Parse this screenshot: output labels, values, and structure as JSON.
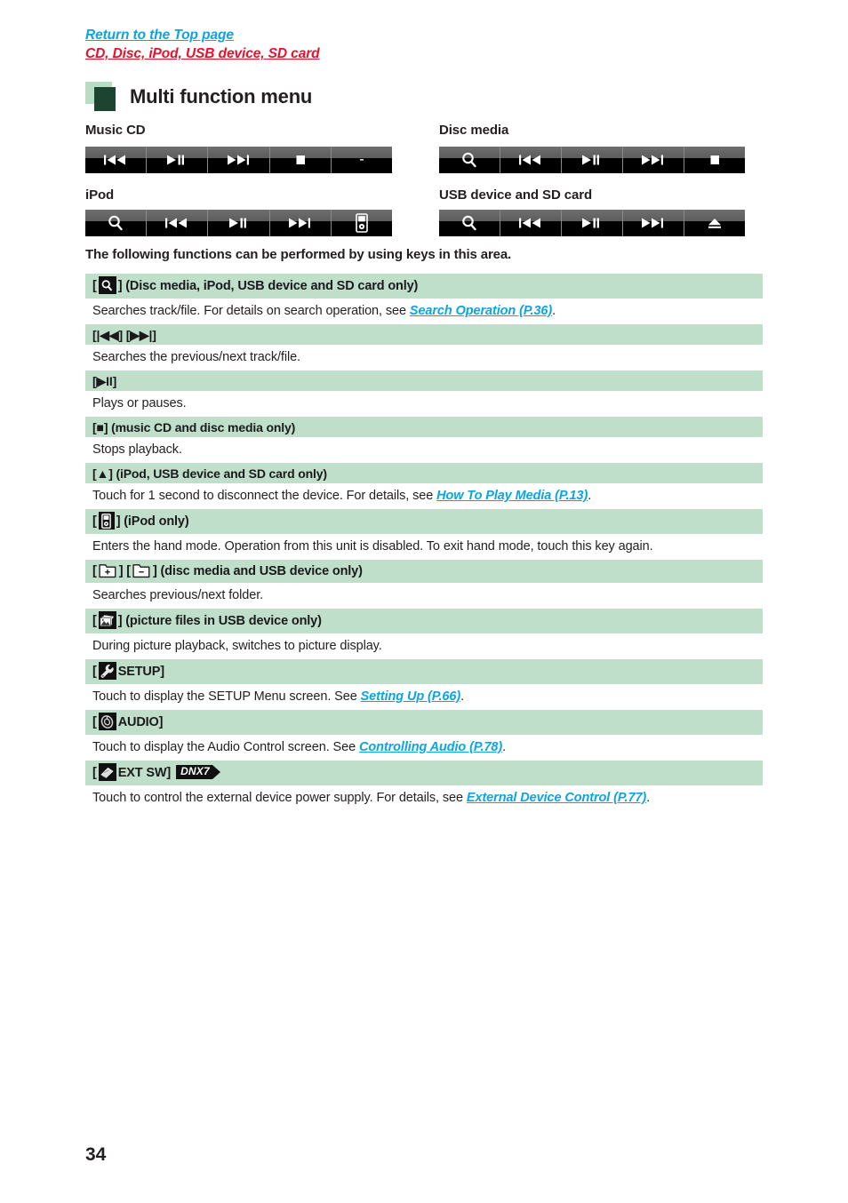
{
  "header": {
    "return_link": "Return to the Top page",
    "breadcrumb": "CD, Disc, iPod, USB device, SD card",
    "title": "Multi function menu"
  },
  "control_bars": [
    {
      "label": "Music CD",
      "keys": [
        "prev-track-icon",
        "play-pause-icon",
        "next-track-icon",
        "stop-icon",
        "blank-key"
      ]
    },
    {
      "label": "Disc media",
      "keys": [
        "search-icon",
        "prev-track-icon",
        "play-pause-icon",
        "next-track-icon",
        "stop-icon"
      ]
    },
    {
      "label": "iPod",
      "keys": [
        "search-icon",
        "prev-track-icon",
        "play-pause-icon",
        "next-track-icon",
        "ipod-hand-mode-icon"
      ]
    },
    {
      "label": "USB device and SD card",
      "keys": [
        "search-icon",
        "prev-track-icon",
        "play-pause-icon",
        "next-track-icon",
        "eject-icon"
      ]
    }
  ],
  "intro": "The following functions can be performed by using keys in this area.",
  "entries": [
    {
      "term_prefix": "[",
      "term_suffix": "] (Disc media, iPod, USB device and SD card only)",
      "desc_before": "Searches track/file. For details on search operation, see ",
      "desc_link": "Search Operation (P.36)",
      "desc_after": "."
    },
    {
      "term_text": "[|◀◀] [▶▶|]",
      "desc_before": "Searches the previous/next track/file.",
      "desc_link": "",
      "desc_after": ""
    },
    {
      "term_text": "[▶II]",
      "desc_before": "Plays or pauses.",
      "desc_link": "",
      "desc_after": ""
    },
    {
      "term_text": "[■] (music CD and disc media only)",
      "desc_before": "Stops playback.",
      "desc_link": "",
      "desc_after": ""
    },
    {
      "term_text": "[▲] (iPod, USB device and SD card only)",
      "desc_before": "Touch for 1 second to disconnect the device. For details, see ",
      "desc_link": "How To Play Media (P.13)",
      "desc_after": "."
    },
    {
      "term_prefix": "[",
      "term_suffix": "] (iPod only)",
      "desc_before": "Enters the hand mode. Operation from this unit is disabled. To exit hand mode, touch this key again.",
      "desc_link": "",
      "desc_after": ""
    },
    {
      "term_prefix": "[",
      "term_middle": "] [",
      "term_suffix": "] (disc media and USB device only)",
      "desc_before": "Searches previous/next folder.",
      "desc_link": "",
      "desc_after": ""
    },
    {
      "term_prefix": "[",
      "term_suffix": "] (picture files in USB device only)",
      "desc_before": "During picture playback, switches to picture display.",
      "desc_link": "",
      "desc_after": ""
    },
    {
      "term_prefix": "[",
      "term_suffix": "SETUP]",
      "desc_before": "Touch to display the SETUP Menu screen. See ",
      "desc_link": "Setting Up (P.66)",
      "desc_after": "."
    },
    {
      "term_prefix": "[",
      "term_suffix": "AUDIO]",
      "desc_before": "Touch to display the Audio Control screen. See ",
      "desc_link": "Controlling Audio (P.78)",
      "desc_after": "."
    },
    {
      "term_prefix": "[",
      "term_suffix": "EXT SW]",
      "badge": "DNX7",
      "desc_before": "Touch to control the external device power supply. For details, see ",
      "desc_link": "External Device Control (P.77)",
      "desc_after": "."
    }
  ],
  "page_number": "34",
  "colors": {
    "link_blue": "#0aa5e2",
    "breadcrumb_red": "#e8112d",
    "term_green": "#bfdfcb",
    "heading_dark_green": "#1d4431",
    "heading_light_green": "#b8dcc4",
    "bar_black": "#000000",
    "bar_gray": "#6f6f6f"
  }
}
